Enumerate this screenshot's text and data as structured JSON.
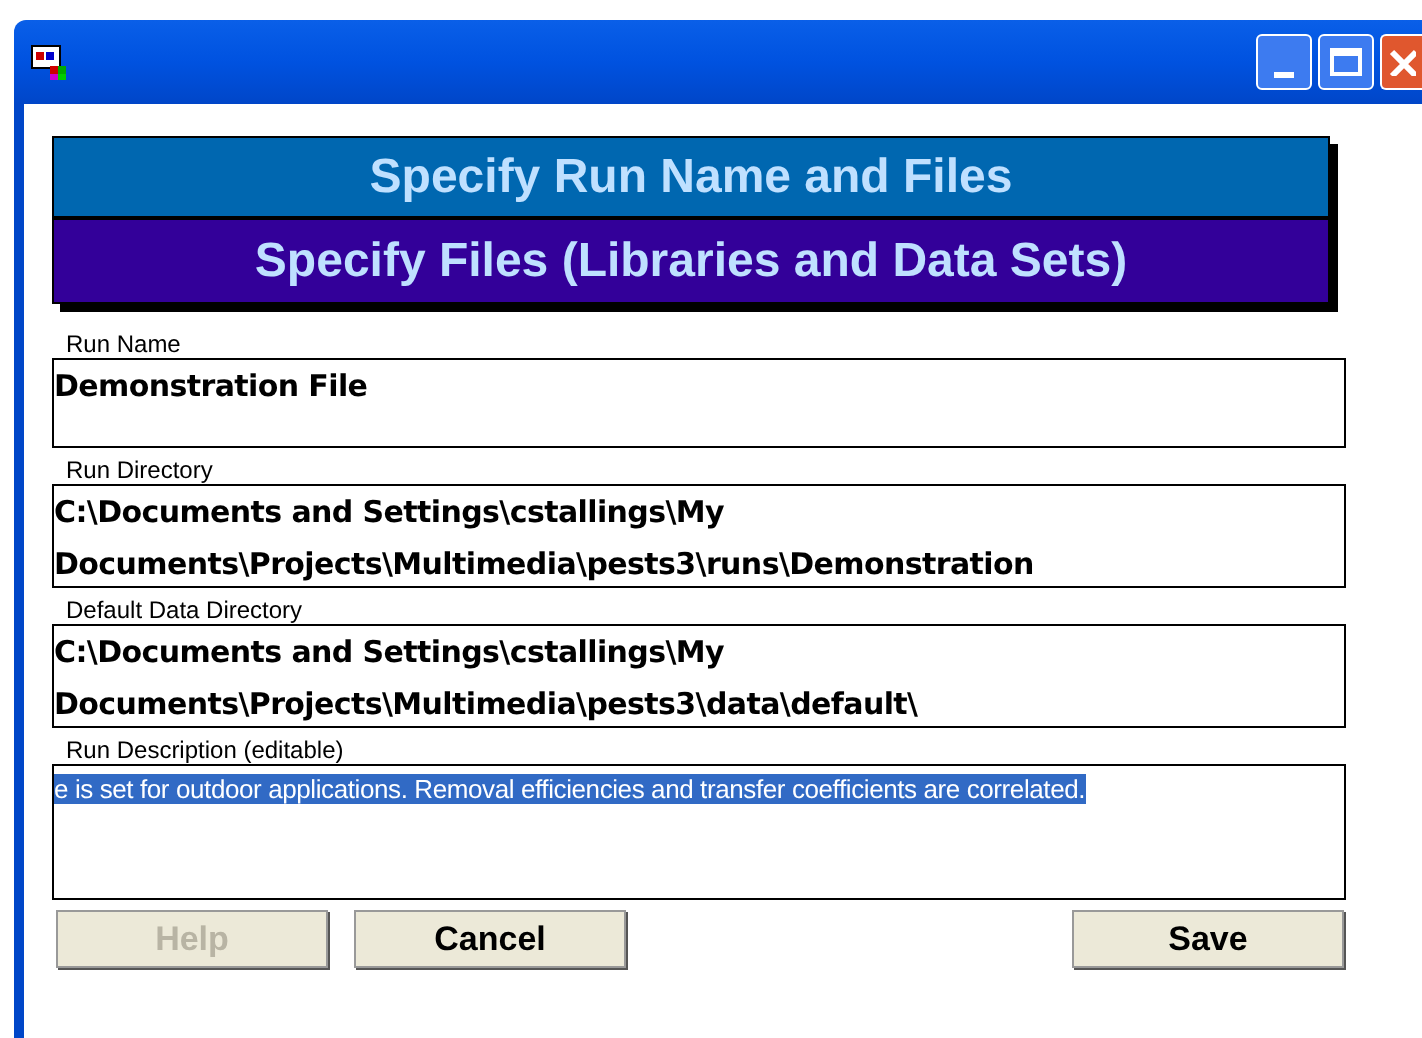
{
  "banner": {
    "title": "Specify Run Name and Files",
    "subtitle": "Specify Files (Libraries and Data Sets)"
  },
  "fields": [
    {
      "label": "Run Name",
      "value": "Demonstration File",
      "kind": "bold",
      "selected": false
    },
    {
      "label": "Run Directory",
      "value": "C:\\Documents and Settings\\cstallings\\My Documents\\Projects\\Multimedia\\pests3\\runs\\Demonstration",
      "kind": "bold",
      "selected": false
    },
    {
      "label": "Default Data Directory",
      "value": "C:\\Documents and Settings\\cstallings\\My Documents\\Projects\\Multimedia\\pests3\\data\\default\\",
      "kind": "bold",
      "selected": false
    },
    {
      "label": "Run Description (editable)",
      "value": "e is set for outdoor applications. Removal efficiencies and transfer coefficients are correlated.",
      "kind": "plain",
      "selected": true
    }
  ],
  "buttons": [
    {
      "label": "Help",
      "disabled": true
    },
    {
      "label": "Cancel",
      "disabled": false
    },
    {
      "label": "Save",
      "disabled": false
    }
  ]
}
